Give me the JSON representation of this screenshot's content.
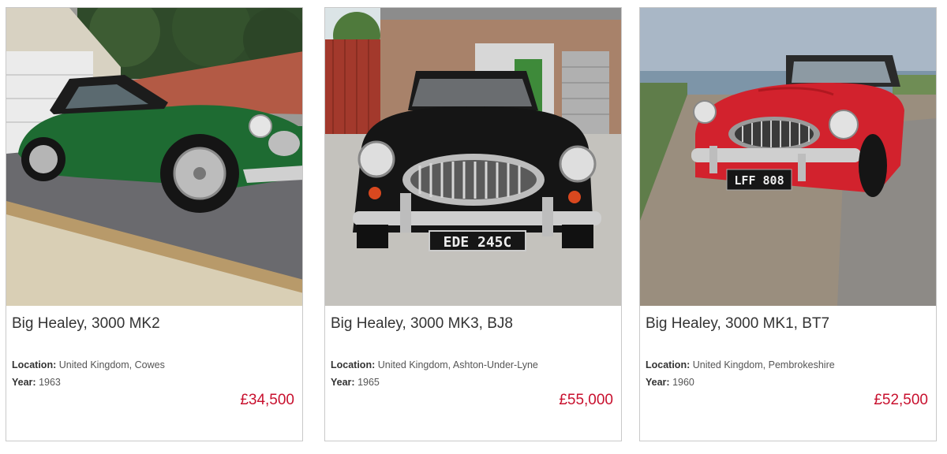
{
  "colors": {
    "price": "#c8102e",
    "card_border": "#c9c9c9",
    "title_text": "#333333",
    "car_green": "#1e6b32",
    "car_black": "#151515",
    "car_red": "#d2222d"
  },
  "listings": [
    {
      "title": "Big Healey, 3000 MK2",
      "location_label": "Location:",
      "location": "United Kingdom, Cowes",
      "year_label": "Year:",
      "year": "1963",
      "price": "£34,500"
    },
    {
      "title": "Big Healey, 3000 MK3, BJ8",
      "location_label": "Location:",
      "location": "United Kingdom, Ashton-Under-Lyne",
      "year_label": "Year:",
      "year": "1965",
      "price": "£55,000",
      "plate": "EDE 245C"
    },
    {
      "title": "Big Healey, 3000 MK1, BT7",
      "location_label": "Location:",
      "location": "United Kingdom, Pembrokeshire",
      "year_label": "Year:",
      "year": "1960",
      "price": "£52,500",
      "plate": "LFF 808"
    }
  ]
}
